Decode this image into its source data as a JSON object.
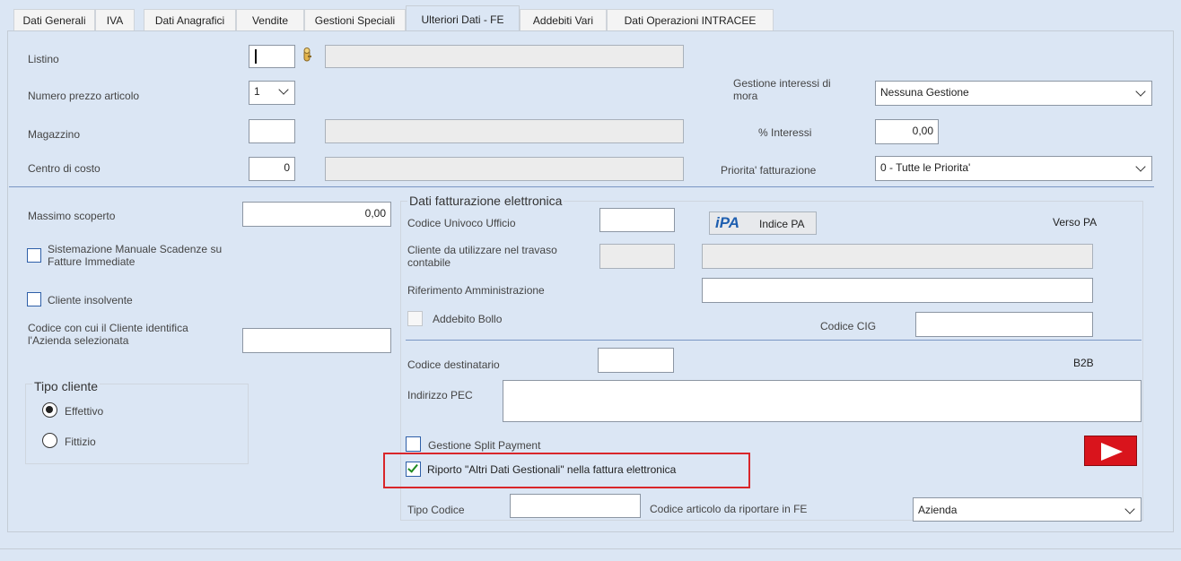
{
  "tabs": [
    {
      "label": "Dati Generali"
    },
    {
      "label": "IVA"
    },
    {
      "label": "Dati Anagrafici"
    },
    {
      "label": "Vendite"
    },
    {
      "label": "Gestioni Speciali"
    },
    {
      "label": "Ulteriori Dati - FE"
    },
    {
      "label": "Addebiti Vari"
    },
    {
      "label": "Dati Operazioni INTRACEE"
    }
  ],
  "left": {
    "listino_label": "Listino",
    "numero_prezzo_label": "Numero prezzo articolo",
    "numero_prezzo_value": "1",
    "magazzino_label": "Magazzino",
    "centro_costo_label": "Centro di costo",
    "centro_costo_value": "0",
    "massimo_scoperto_label": "Massimo scoperto",
    "massimo_scoperto_value": "0,00",
    "sistemazione_label": "Sistemazione Manuale Scadenze su Fatture Immediate",
    "cliente_insolvente_label": "Cliente insolvente",
    "codice_cliente_label": "Codice con cui il Cliente identifica l'Azienda selezionata",
    "tipo_cliente_title": "Tipo cliente",
    "effettivo_label": "Effettivo",
    "fittizio_label": "Fittizio"
  },
  "right_top": {
    "interessi_mora_label": "Gestione interessi di mora",
    "interessi_mora_value": "Nessuna Gestione",
    "perc_interessi_label": "% Interessi",
    "perc_interessi_value": "0,00",
    "priorita_label": "Priorita' fatturazione",
    "priorita_value": "0 - Tutte le Priorita'"
  },
  "fe": {
    "title": "Dati fatturazione elettronica",
    "codice_univoco_label": "Codice Univoco Ufficio",
    "ipa_logo": "iPA",
    "indice_pa_label": "Indice PA",
    "verso_pa_label": "Verso PA",
    "cliente_travaso_label": "Cliente da utilizzare nel travaso contabile",
    "riferimento_label": "Riferimento Amministrazione",
    "addebito_bollo_label": "Addebito Bollo",
    "codice_cig_label": "Codice CIG",
    "codice_destinatario_label": "Codice destinatario",
    "b2b_label": "B2B",
    "indirizzo_pec_label": "Indirizzo PEC",
    "split_payment_label": "Gestione Split Payment",
    "riporto_label": "Riporto \"Altri Dati Gestionali\"  nella fattura elettronica",
    "tipo_codice_label": "Tipo Codice",
    "codice_articolo_label": "Codice articolo da riportare in FE",
    "codice_articolo_value": "Azienda"
  },
  "colors": {
    "accent_red": "#d9262a",
    "play_red": "#d9141c",
    "panel_bg": "#dbe6f4"
  }
}
